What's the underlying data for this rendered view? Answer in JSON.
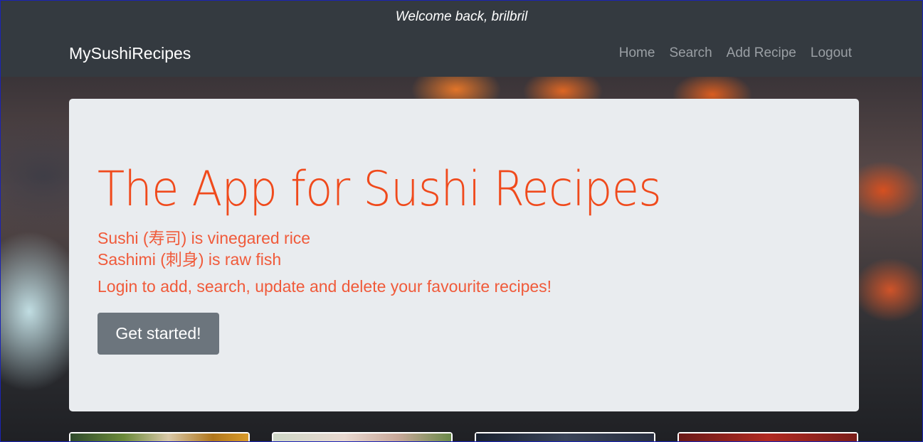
{
  "welcome": {
    "text": "Welcome back, brilbril"
  },
  "navbar": {
    "brand": "MySushiRecipes",
    "links": [
      {
        "label": "Home"
      },
      {
        "label": "Search"
      },
      {
        "label": "Add Recipe"
      },
      {
        "label": "Logout"
      }
    ]
  },
  "hero": {
    "title": "The App for Sushi Recipes",
    "line1": "Sushi (寿司) is vinegared rice",
    "line2": "Sashimi (刺身) is raw fish",
    "line3": "Login to add, search, update and delete your favourite recipes!",
    "button_label": "Get started!"
  },
  "colors": {
    "navbar_bg": "#343a40",
    "jumbotron_bg": "#e9ecef",
    "accent_orange": "#f04a1c",
    "button_bg": "#6c757d"
  }
}
